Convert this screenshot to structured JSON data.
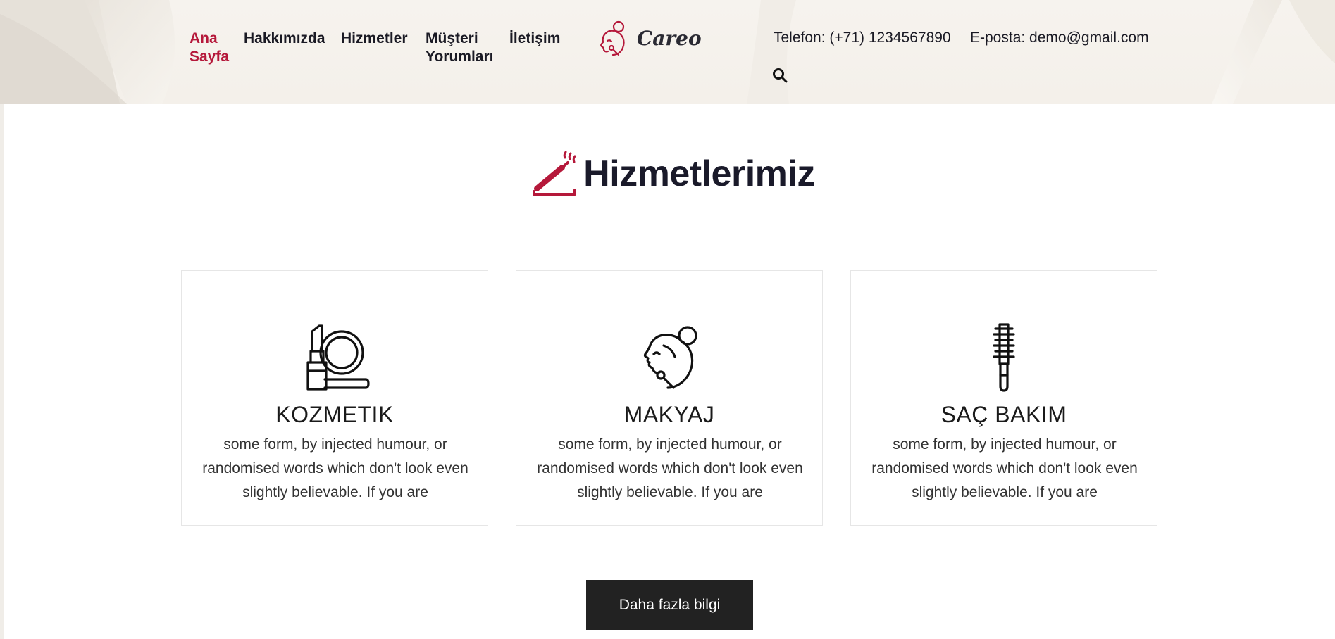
{
  "nav": {
    "items": [
      {
        "label": "Ana Sayfa",
        "active": true
      },
      {
        "label": "Hakkımızda",
        "active": false
      },
      {
        "label": "Hizmetler",
        "active": false
      },
      {
        "label": "Müşteri Yorumları",
        "active": false
      },
      {
        "label": "İletişim",
        "active": false
      }
    ]
  },
  "brand": {
    "name": "Careo",
    "logo_icon": "woman-face-logo-icon"
  },
  "contact": {
    "phone": "Telefon: (+71) 1234567890",
    "email": "E-posta: demo@gmail.com"
  },
  "search": {
    "icon": "search-icon"
  },
  "services": {
    "title": "Hizmetlerimiz",
    "title_icon": "mascara-brush-icon",
    "cards": [
      {
        "title": "KOZMETIK",
        "icon": "lipstick-compact-icon",
        "description": "some form, by injected humour, or randomised words which don't look even slightly believable. If you are"
      },
      {
        "title": "MAKYAJ",
        "icon": "face-makeup-icon",
        "description": "some form, by injected humour, or randomised words which don't look even slightly believable. If you are"
      },
      {
        "title": "SAÇ BAKIM",
        "icon": "hair-brush-icon",
        "description": "some form, by injected humour, or randomised words which don't look even slightly believable. If you are"
      }
    ],
    "more_button": "Daha fazla bilgi"
  },
  "colors": {
    "accent": "#b5183a",
    "text_dark": "#1a1a24",
    "button_bg": "#222222",
    "header_bg": "#f4f0ea"
  }
}
